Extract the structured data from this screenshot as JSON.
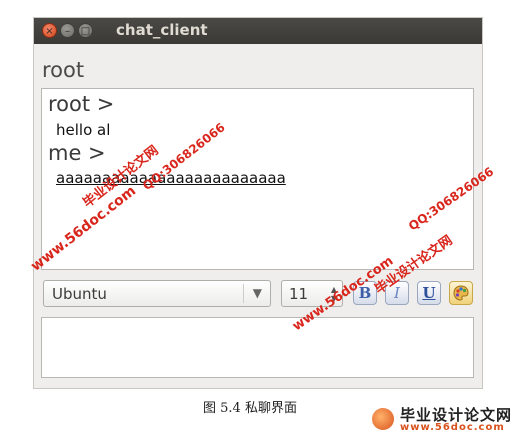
{
  "window": {
    "title": "chat_client",
    "close_glyph": "×",
    "min_glyph": "–",
    "max_glyph": "□"
  },
  "peer_label": "root",
  "messages": [
    {
      "sender": "root >",
      "text": "hello al",
      "underline": false
    },
    {
      "sender": "me >",
      "text": "aaaaaaaaaaaaaaaaaaaaaaaaa",
      "underline": true
    }
  ],
  "toolbar": {
    "font_family": "Ubuntu",
    "font_size": "11",
    "bold_label": "B",
    "italic_label": "I",
    "underline_label": "U",
    "color_icon": "palette-icon"
  },
  "input": {
    "value": ""
  },
  "caption": "图 5.4    私聊界面",
  "watermark": {
    "site": "www.56doc.com",
    "qq": "QQ:306826066",
    "name": "毕业设计论文网"
  },
  "brand": {
    "name": "毕业设计论文网",
    "url": "www.56doc.com"
  }
}
